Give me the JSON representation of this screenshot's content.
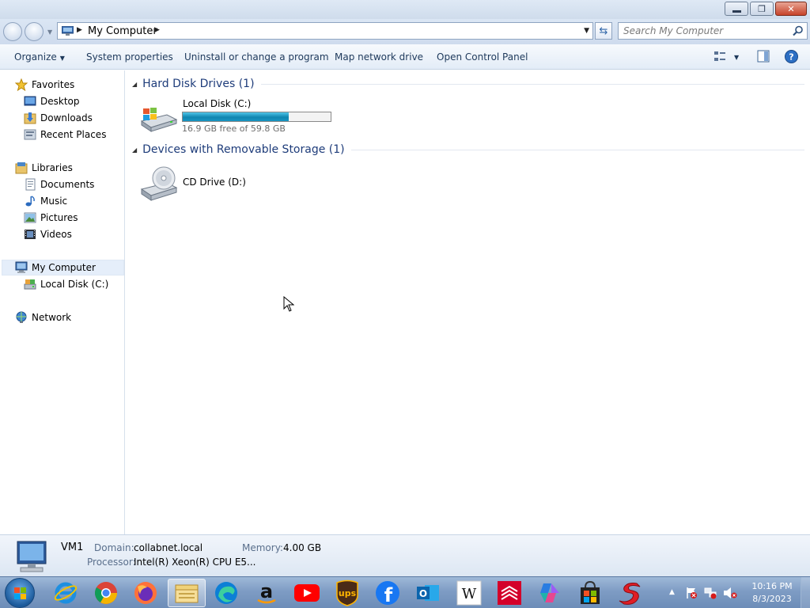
{
  "window": {
    "minimize_glyph": "",
    "maximize_glyph": "❐",
    "close_glyph": "✕"
  },
  "address_bar": {
    "path": "My Computer",
    "search_placeholder": "Search My Computer"
  },
  "command_bar": {
    "organize": "Organize",
    "system_properties": "System properties",
    "uninstall": "Uninstall or change a program",
    "map_network_drive": "Map network drive",
    "open_control_panel": "Open Control Panel"
  },
  "nav": {
    "favorites": "Favorites",
    "desktop": "Desktop",
    "downloads": "Downloads",
    "recent_places": "Recent Places",
    "libraries": "Libraries",
    "documents": "Documents",
    "music": "Music",
    "pictures": "Pictures",
    "videos": "Videos",
    "my_computer": "My Computer",
    "local_disk": "Local Disk (C:)",
    "network": "Network"
  },
  "content": {
    "hard_disk_header": "Hard Disk Drives (1)",
    "local_disk_name": "Local Disk (C:)",
    "local_disk_free": "16.9 GB free of 59.8 GB",
    "local_disk_used_fraction": 0.717,
    "removable_header": "Devices with Removable Storage (1)",
    "cd_drive_name": "CD Drive (D:)"
  },
  "details": {
    "computer_name": "VM1",
    "domain_label": "Domain:",
    "domain_value": "collabnet.local",
    "memory_label": "Memory:",
    "memory_value": "4.00 GB",
    "processor_label": "Processor:",
    "processor_value": "Intel(R) Xeon(R) CPU E5..."
  },
  "taskbar": {
    "apps": [
      "internet-explorer",
      "chrome",
      "firefox",
      "file-explorer",
      "edge",
      "amazon",
      "youtube",
      "ups",
      "facebook",
      "outlook",
      "wikipedia",
      "bank-of-america",
      "copilot",
      "microsoft-store",
      "speedway"
    ],
    "wikipedia_glyph": "W",
    "ups_glyph": "ups",
    "amazon_glyph": "a",
    "facebook_glyph": "f",
    "outlook_glyph": "O",
    "time": "10:16 PM",
    "date": "8/3/2023"
  },
  "colors": {
    "drive_bar": "#1895c1",
    "group_header": "#1e3c7a",
    "taskbar": "#7e9cc4"
  }
}
